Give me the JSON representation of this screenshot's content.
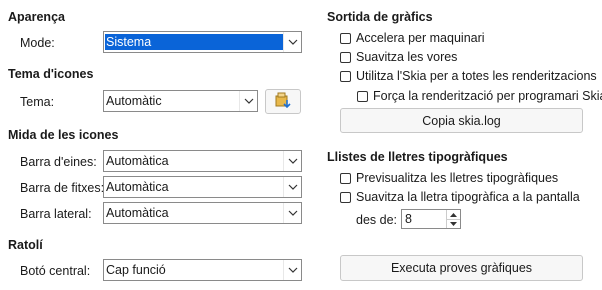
{
  "appearance": {
    "header": "Aparença",
    "mode_label": "Mode:",
    "mode_value": "Sistema"
  },
  "icon_theme": {
    "header": "Tema d'icones",
    "theme_label": "Tema:",
    "theme_value": "Automàtic"
  },
  "icon_size": {
    "header": "Mida de les icones",
    "toolbar_label": "Barra d'eines:",
    "toolbar_value": "Automàtica",
    "tabbar_label": "Barra de fitxes:",
    "tabbar_value": "Automàtica",
    "sidebar_label": "Barra lateral:",
    "sidebar_value": "Automàtica"
  },
  "mouse": {
    "header": "Ratolí",
    "middle_label": "Botó central:",
    "middle_value": "Cap funció"
  },
  "graphics_output": {
    "header": "Sortida de gràfics",
    "hw_accel": "Accelera per maquinari",
    "antialias": "Suavitza les vores",
    "skia_all": "Utilitza l'Skia per a totes les renderitzacions",
    "skia_software": "Força la renderització per programari Skia",
    "copy_skia_log": "Copia skia.log"
  },
  "font_lists": {
    "header": "Llistes de lletres tipogràfiques",
    "preview": "Previsualitza les lletres tipogràfiques",
    "screen_aa": "Suavitza la lletra tipogràfica a la pantalla",
    "from_label": "des de:",
    "from_value": "8"
  },
  "run_tests": "Executa proves gràfiques",
  "icons": {
    "combo_arrow": "chevron-down-icon",
    "add_theme": "add-icon-theme-icon",
    "spin_up": "triangle-up-icon",
    "spin_down": "triangle-down-icon"
  }
}
